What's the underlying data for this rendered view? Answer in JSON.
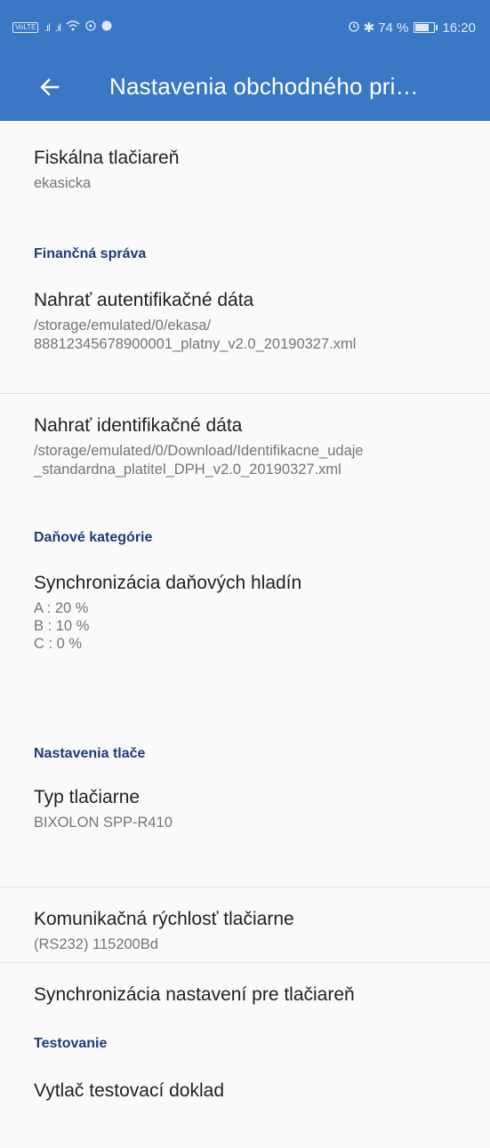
{
  "status_bar": {
    "volte": "VoLTE",
    "battery_text": "74 %",
    "battery_level": 0.74,
    "time": "16:20"
  },
  "app_bar": {
    "title": "Nastavenia obchodného pri…",
    "back_icon": "arrow-back-icon",
    "bg_color": "#3a78c6"
  },
  "items": {
    "printer": {
      "title": "Fiskálna tlačiareň",
      "subtitle": "ekasicka"
    },
    "auth": {
      "title": "Nahrať autentifikačné dáta",
      "subtitle_lines": [
        "/storage/emulated/0/ekasa/",
        "88812345678900001_platny_v2.0_20190327.xml"
      ]
    },
    "ident": {
      "title": "Nahrať identifikačné dáta",
      "subtitle_lines": [
        "/storage/emulated/0/Download/Identifikacne_udaje",
        "_standardna_platitel_DPH_v2.0_20190327.xml"
      ]
    },
    "tax_sync": {
      "title": "Synchronizácia daňových hladín",
      "subtitle_lines": [
        "A : 20 %",
        "B : 10 %",
        "C : 0 %"
      ]
    },
    "printer_type": {
      "title": "Typ tlačiarne",
      "subtitle": "BIXOLON SPP-R410"
    },
    "printer_speed": {
      "title": "Komunikačná rýchlosť tlačiarne",
      "subtitle": "(RS232) 115200Bd"
    },
    "printer_sync": {
      "title": "Synchronizácia nastavení pre tlačiareň"
    },
    "test_print": {
      "title": "Vytlač testovací doklad"
    }
  },
  "sections": {
    "financial": "Finančná správa",
    "tax": "Daňové kategórie",
    "print": "Nastavenia tlače",
    "testing": "Testovanie"
  },
  "colors": {
    "section_header": "#1f3a78",
    "accent": "#3a78c6"
  }
}
